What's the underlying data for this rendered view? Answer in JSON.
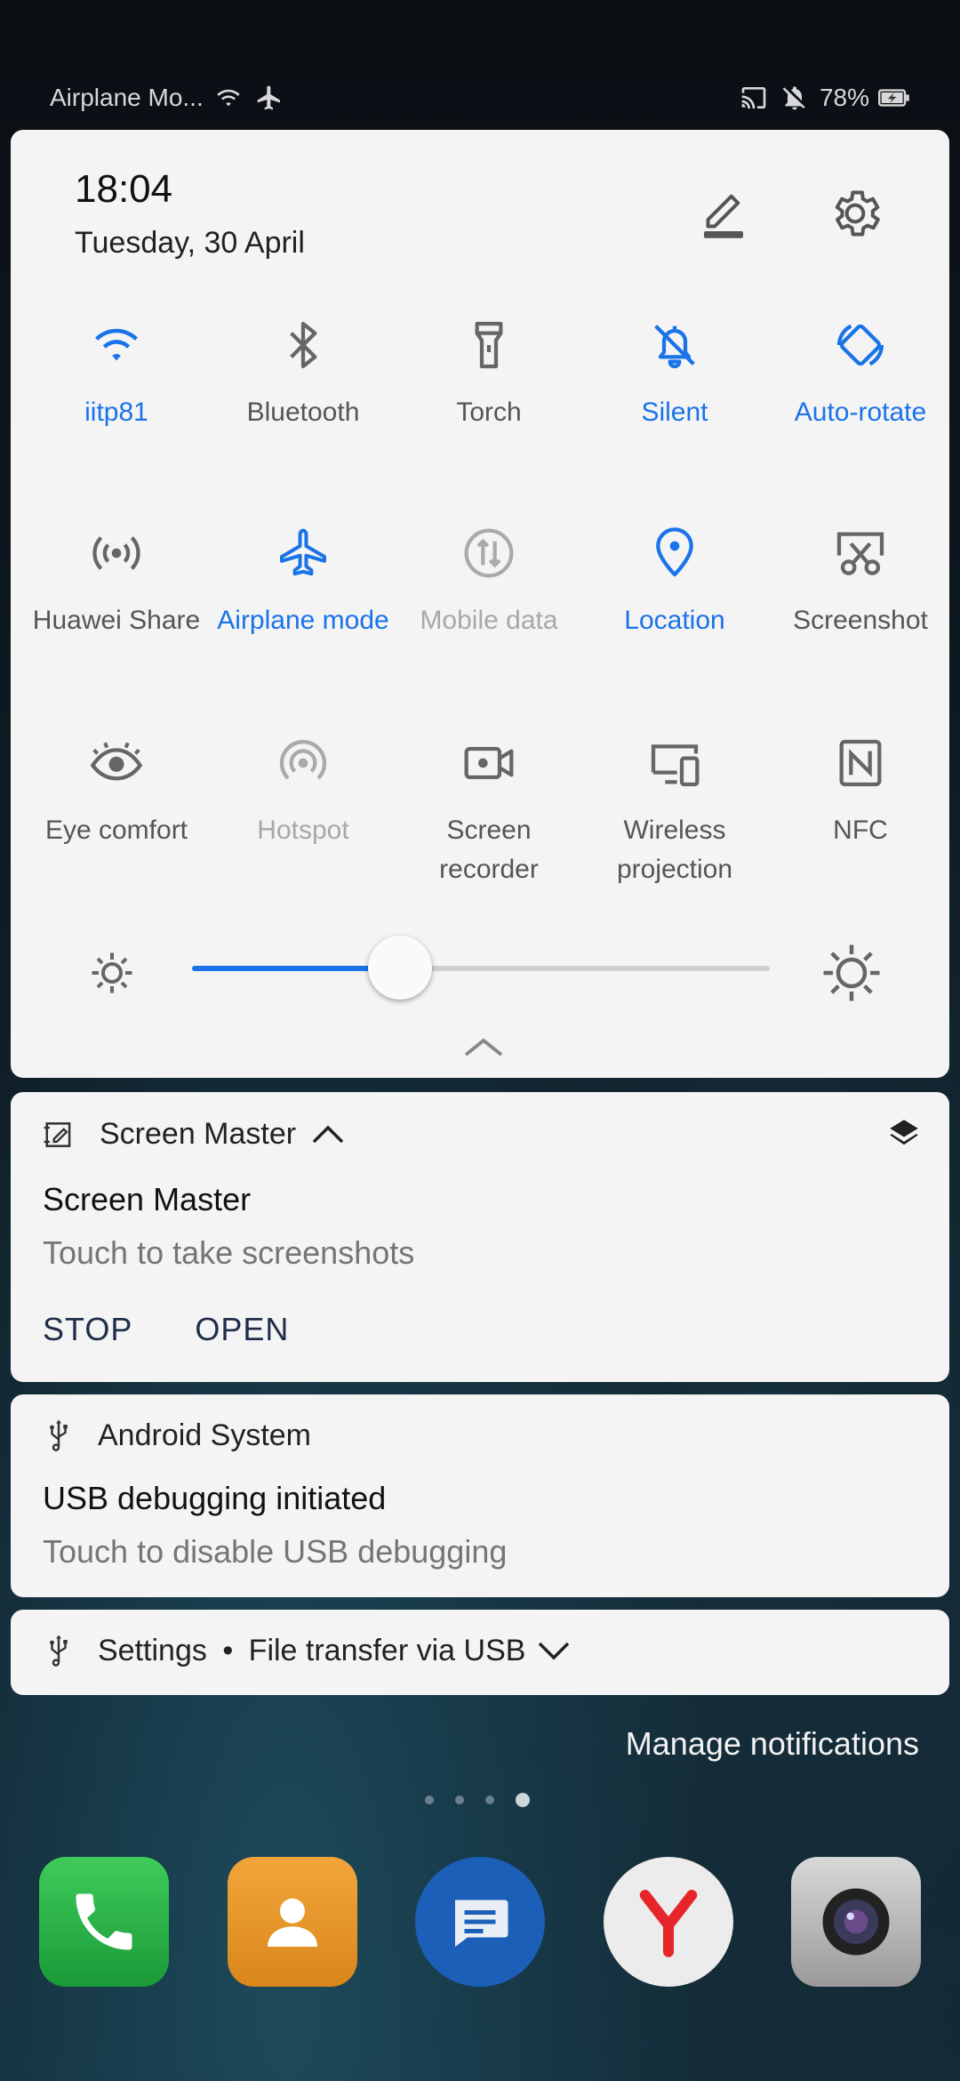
{
  "status_bar": {
    "carrier_text": "Airplane Mo...",
    "battery_percent": "78%",
    "icons": [
      "wifi-icon",
      "airplane-icon",
      "cast-icon",
      "bell-off-icon",
      "battery-charging-icon"
    ]
  },
  "header": {
    "time": "18:04",
    "date": "Tuesday, 30 April",
    "edit_icon": "pencil-icon",
    "settings_icon": "gear-icon"
  },
  "tiles": [
    {
      "label": "iitp81",
      "icon": "wifi-icon",
      "state": "on"
    },
    {
      "label": "Bluetooth",
      "icon": "bluetooth-icon",
      "state": "default"
    },
    {
      "label": "Torch",
      "icon": "torch-icon",
      "state": "default"
    },
    {
      "label": "Silent",
      "icon": "bell-off-icon",
      "state": "on"
    },
    {
      "label": "Auto-rotate",
      "icon": "rotate-icon",
      "state": "on"
    },
    {
      "label": "Huawei Share",
      "icon": "share-icon",
      "state": "default"
    },
    {
      "label": "Airplane mode",
      "icon": "airplane-icon",
      "state": "on"
    },
    {
      "label": "Mobile data",
      "icon": "mobile-data-icon",
      "state": "off"
    },
    {
      "label": "Location",
      "icon": "location-pin-icon",
      "state": "on"
    },
    {
      "label": "Screenshot",
      "icon": "screenshot-icon",
      "state": "default"
    },
    {
      "label": "Eye comfort",
      "icon": "eye-icon",
      "state": "default"
    },
    {
      "label": "Hotspot",
      "icon": "hotspot-icon",
      "state": "off"
    },
    {
      "label": "Screen\nrecorder",
      "icon": "screen-recorder-icon",
      "state": "default"
    },
    {
      "label": "Wireless\nprojection",
      "icon": "wireless-projection-icon",
      "state": "default"
    },
    {
      "label": "NFC",
      "icon": "nfc-icon",
      "state": "default"
    }
  ],
  "brightness": {
    "level": 0.36,
    "low_icon": "sun-low-icon",
    "high_icon": "sun-high-icon"
  },
  "notifications": [
    {
      "app": "Screen Master",
      "title": "Screen Master",
      "body": "Touch to take screenshots",
      "actions": [
        "STOP",
        "OPEN"
      ]
    },
    {
      "app": "Android System",
      "title": "USB debugging initiated",
      "body": "Touch to disable USB debugging"
    },
    {
      "app": "Settings",
      "separator": "•",
      "summary": "File transfer via USB"
    }
  ],
  "manage_notifications": "Manage notifications",
  "colors": {
    "accent": "#1a73e8",
    "panel": "#f4f4f4",
    "inactive": "#a8a8a8"
  },
  "dock": {
    "apps": [
      "phone-icon",
      "contacts-icon",
      "messages-icon",
      "yandex-browser-icon",
      "camera-icon"
    ]
  }
}
